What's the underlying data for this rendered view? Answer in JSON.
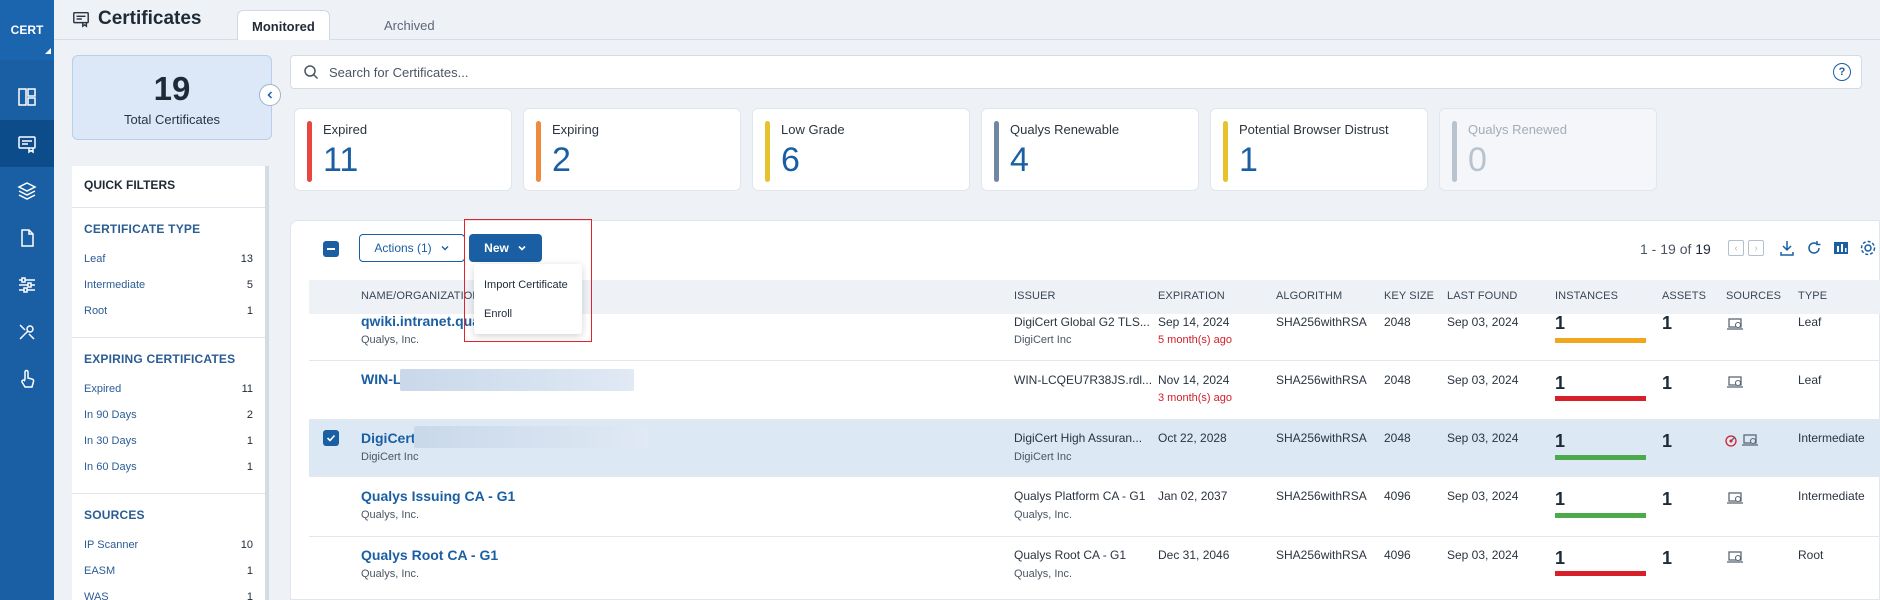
{
  "nav": {
    "logo": "CERT"
  },
  "header": {
    "title": "Certificates",
    "tabs": [
      {
        "label": "Monitored"
      },
      {
        "label": "Archived"
      }
    ]
  },
  "total": {
    "count": "19",
    "label": "Total Certificates"
  },
  "filters": {
    "title": "QUICK FILTERS",
    "sections": [
      {
        "title": "CERTIFICATE TYPE",
        "items": [
          {
            "label": "Leaf",
            "count": "13"
          },
          {
            "label": "Intermediate",
            "count": "5"
          },
          {
            "label": "Root",
            "count": "1"
          }
        ]
      },
      {
        "title": "EXPIRING CERTIFICATES",
        "items": [
          {
            "label": "Expired",
            "count": "11"
          },
          {
            "label": "In 90 Days",
            "count": "2"
          },
          {
            "label": "In 30 Days",
            "count": "1"
          },
          {
            "label": "In 60 Days",
            "count": "1"
          }
        ]
      },
      {
        "title": "SOURCES",
        "items": [
          {
            "label": "IP Scanner",
            "count": "10"
          },
          {
            "label": "EASM",
            "count": "1"
          },
          {
            "label": "WAS",
            "count": "1"
          }
        ]
      }
    ]
  },
  "search": {
    "placeholder": "Search for Certificates...",
    "help": "?"
  },
  "cards": [
    {
      "label": "Expired",
      "value": "11",
      "color": "#e8473f"
    },
    {
      "label": "Expiring",
      "value": "2",
      "color": "#f08a3c"
    },
    {
      "label": "Low Grade",
      "value": "6",
      "color": "#e6c22f"
    },
    {
      "label": "Qualys Renewable",
      "value": "4",
      "color": "#6f87a0"
    },
    {
      "label": "Potential Browser Distrust",
      "value": "1",
      "color": "#e6c22f"
    },
    {
      "label": "Qualys Renewed",
      "value": "0",
      "color": "#b8c3cf"
    }
  ],
  "toolbar": {
    "actions_label": "Actions (1)",
    "new_label": "New",
    "menu": [
      "Import Certificate",
      "Enroll"
    ],
    "pager_range": "1 - 19 of",
    "pager_total": "19"
  },
  "table": {
    "columns": [
      "NAME/ORGANIZATION",
      "ISSUER",
      "EXPIRATION",
      "ALGORITHM",
      "KEY SIZE",
      "LAST FOUND",
      "INSTANCES",
      "ASSETS",
      "SOURCES",
      "TYPE"
    ],
    "rows": [
      {
        "name": "qwiki.intranet.qua",
        "org": "Qualys, Inc.",
        "issuer": "DigiCert Global G2 TLS...",
        "issuer_org": "DigiCert Inc",
        "expiration": "Sep 14, 2024",
        "exp_note": "5 month(s) ago",
        "algorithm": "SHA256withRSA",
        "key_size": "2048",
        "last_found": "Sep 03, 2024",
        "instances": "1",
        "assets": "1",
        "type": "Leaf",
        "bar_color": "#f2a51e"
      },
      {
        "name": "WIN-L",
        "org": "",
        "issuer": "WIN-LCQEU7R38JS.rdl...",
        "issuer_org": "",
        "expiration": "Nov 14, 2024",
        "exp_note": "3 month(s) ago",
        "algorithm": "SHA256withRSA",
        "key_size": "2048",
        "last_found": "Sep 03, 2024",
        "instances": "1",
        "assets": "1",
        "type": "Leaf",
        "bar_color": "#d8202a"
      },
      {
        "name": "DigiCert",
        "org": "DigiCert Inc",
        "issuer": "DigiCert High Assuran...",
        "issuer_org": "DigiCert Inc",
        "expiration": "Oct 22, 2028",
        "exp_note": "",
        "algorithm": "SHA256withRSA",
        "key_size": "2048",
        "last_found": "Sep 03, 2024",
        "instances": "1",
        "assets": "1",
        "type": "Intermediate",
        "bar_color": "#4caa4a"
      },
      {
        "name": "Qualys Issuing CA - G1",
        "org": "Qualys, Inc.",
        "issuer": "Qualys Platform CA - G1",
        "issuer_org": "Qualys, Inc.",
        "expiration": "Jan 02, 2037",
        "exp_note": "",
        "algorithm": "SHA256withRSA",
        "key_size": "4096",
        "last_found": "Sep 03, 2024",
        "instances": "1",
        "assets": "1",
        "type": "Intermediate",
        "bar_color": "#4caa4a"
      },
      {
        "name": "Qualys Root CA - G1",
        "org": "Qualys, Inc.",
        "issuer": "Qualys Root CA - G1",
        "issuer_org": "Qualys, Inc.",
        "expiration": "Dec 31, 2046",
        "exp_note": "",
        "algorithm": "SHA256withRSA",
        "key_size": "4096",
        "last_found": "Sep 03, 2024",
        "instances": "1",
        "assets": "1",
        "type": "Root",
        "bar_color": "#d8202a"
      }
    ]
  }
}
